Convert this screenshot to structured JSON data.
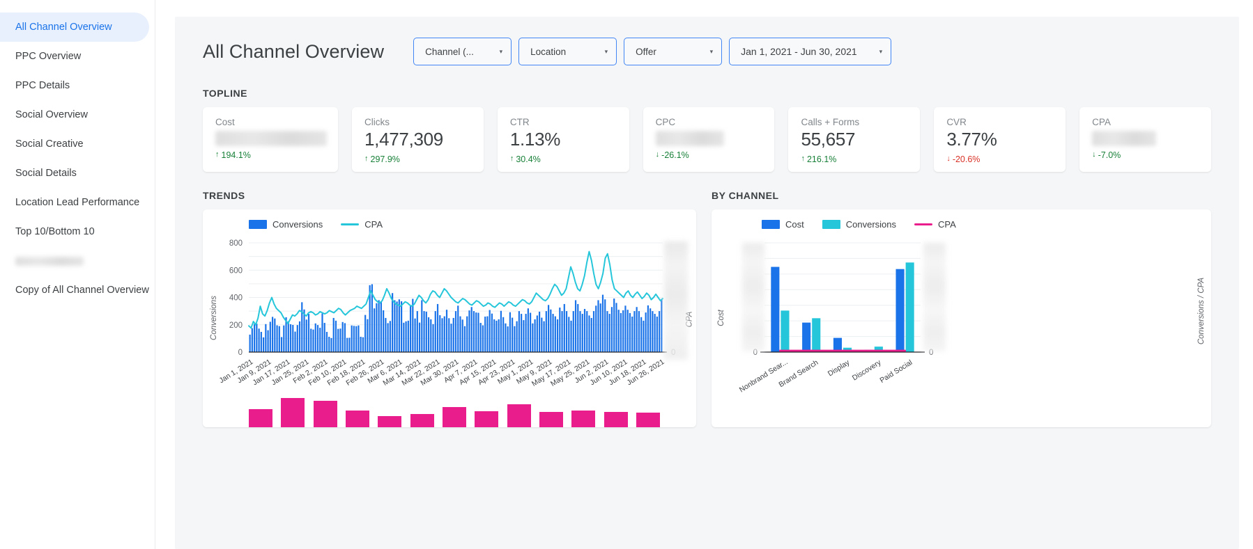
{
  "sidebar": {
    "items": [
      {
        "label": "All Channel Overview",
        "active": true,
        "redacted": false
      },
      {
        "label": "PPC Overview",
        "active": false,
        "redacted": false
      },
      {
        "label": "PPC Details",
        "active": false,
        "redacted": false
      },
      {
        "label": "Social Overview",
        "active": false,
        "redacted": false
      },
      {
        "label": "Social Creative",
        "active": false,
        "redacted": false
      },
      {
        "label": "Social Details",
        "active": false,
        "redacted": false
      },
      {
        "label": "Location Lead Performance",
        "active": false,
        "redacted": false
      },
      {
        "label": "Top 10/Bottom 10",
        "active": false,
        "redacted": false
      },
      {
        "label": "",
        "active": false,
        "redacted": true
      },
      {
        "label": "Copy of All Channel Overview",
        "active": false,
        "redacted": false
      }
    ]
  },
  "header": {
    "title": "All Channel Overview",
    "filters": [
      {
        "label": "Channel (...",
        "name": "channel-filter"
      },
      {
        "label": "Location",
        "name": "location-filter"
      },
      {
        "label": "Offer",
        "name": "offer-filter"
      },
      {
        "label": "Jan 1, 2021 - Jun 30, 2021",
        "name": "date-range-filter"
      }
    ],
    "caret": "▾"
  },
  "topline": {
    "title": "TOPLINE",
    "cards": [
      {
        "label": "Cost",
        "value": "",
        "redacted": true,
        "delta": "194.1%",
        "dir": "up",
        "arrow": "↑",
        "tone": "up"
      },
      {
        "label": "Clicks",
        "value": "1,477,309",
        "redacted": false,
        "delta": "297.9%",
        "dir": "up",
        "arrow": "↑",
        "tone": "up"
      },
      {
        "label": "CTR",
        "value": "1.13%",
        "redacted": false,
        "delta": "30.4%",
        "dir": "up",
        "arrow": "↑",
        "tone": "up"
      },
      {
        "label": "CPC",
        "value": "",
        "redacted": true,
        "delta": "-26.1%",
        "dir": "down",
        "arrow": "↓",
        "tone": "down-good"
      },
      {
        "label": "Calls + Forms",
        "value": "55,657",
        "redacted": false,
        "delta": "216.1%",
        "dir": "up",
        "arrow": "↑",
        "tone": "up"
      },
      {
        "label": "CVR",
        "value": "3.77%",
        "redacted": false,
        "delta": "-20.6%",
        "dir": "down",
        "arrow": "↓",
        "tone": "down-bad"
      },
      {
        "label": "CPA",
        "value": "",
        "redacted": true,
        "delta": "-7.0%",
        "dir": "down",
        "arrow": "↓",
        "tone": "down-good"
      }
    ]
  },
  "trends": {
    "title": "TRENDS"
  },
  "by_channel": {
    "title": "BY CHANNEL"
  },
  "colors": {
    "conversions_blue": "#1a73e8",
    "cpa_cyan": "#26c6da",
    "cost_blue": "#1a73e8",
    "conversions_teal": "#26c6da",
    "cpa_pink": "#e91e8c",
    "accent_nav": "#1a73e8",
    "nav_active_bg": "#e8f0fe",
    "positive": "#188038",
    "negative": "#d93025",
    "canvas_bg": "#f5f6f7"
  },
  "chart_data": [
    {
      "type": "bar",
      "name": "trends",
      "title": "TRENDS",
      "xlabel": "",
      "ylabel": "Conversions",
      "y2label": "CPA",
      "ylim": [
        0,
        800
      ],
      "yticks": [
        0,
        200,
        400,
        600,
        800
      ],
      "y2_ticks_redacted": true,
      "grid": true,
      "legend_position": "top-left",
      "legend": [
        "Conversions",
        "CPA"
      ],
      "x_tick_labels": [
        "Jan 1, 2021",
        "Jan 9, 2021",
        "Jan 17, 2021",
        "Jan 25, 2021",
        "Feb 2, 2021",
        "Feb 10, 2021",
        "Feb 18, 2021",
        "Feb 26, 2021",
        "Mar 6, 2021",
        "Mar 14, 2021",
        "Mar 22, 2021",
        "Mar 30, 2021",
        "Apr 7, 2021",
        "Apr 15, 2021",
        "Apr 23, 2021",
        "May 1, 2021",
        "May 9, 2021",
        "May 17, 2021",
        "May 25, 2021",
        "Jun 2, 2021",
        "Jun 10, 2021",
        "Jun 18, 2021",
        "Jun 26, 2021"
      ],
      "x_tick_step_days": 8,
      "series": [
        {
          "name": "Conversions",
          "kind": "bar",
          "axis": "left",
          "color": "#1a73e8",
          "values": [
            128,
            175,
            205,
            208,
            172,
            148,
            108,
            205,
            160,
            222,
            258,
            246,
            196,
            190,
            110,
            195,
            255,
            226,
            204,
            199,
            150,
            198,
            225,
            365,
            312,
            238,
            280,
            171,
            165,
            210,
            198,
            178,
            283,
            214,
            148,
            112,
            103,
            250,
            230,
            170,
            172,
            220,
            212,
            104,
            105,
            195,
            192,
            190,
            195,
            112,
            109,
            272,
            241,
            490,
            497,
            320,
            358,
            380,
            372,
            306,
            250,
            212,
            228,
            432,
            380,
            370,
            386,
            372,
            215,
            225,
            230,
            336,
            390,
            246,
            300,
            216,
            380,
            300,
            296,
            255,
            240,
            205,
            300,
            352,
            270,
            248,
            262,
            310,
            248,
            208,
            250,
            300,
            340,
            262,
            238,
            190,
            262,
            305,
            330,
            300,
            290,
            288,
            214,
            196,
            260,
            262,
            308,
            282,
            240,
            230,
            240,
            302,
            256,
            210,
            188,
            292,
            252,
            190,
            226,
            300,
            280,
            234,
            280,
            320,
            288,
            210,
            240,
            268,
            296,
            252,
            226,
            300,
            345,
            312,
            280,
            262,
            240,
            326,
            300,
            352,
            300,
            258,
            230,
            300,
            380,
            352,
            300,
            280,
            316,
            300,
            268,
            250,
            300,
            340,
            380,
            356,
            420,
            386,
            300,
            280,
            330,
            392,
            360,
            310,
            286,
            306,
            340,
            310,
            286,
            260,
            300,
            330,
            300,
            256,
            230,
            290,
            342,
            320,
            300,
            280,
            260,
            300,
            390
          ]
        },
        {
          "name": "CPA",
          "kind": "line",
          "axis": "right",
          "color": "#26c6da",
          "values_note": "CPA axis values are blurred/redacted in the screenshot; shape plotted on secondary axis",
          "normalized_values": [
            0.24,
            0.22,
            0.28,
            0.25,
            0.31,
            0.42,
            0.35,
            0.33,
            0.38,
            0.45,
            0.5,
            0.44,
            0.4,
            0.38,
            0.36,
            0.32,
            0.29,
            0.26,
            0.3,
            0.34,
            0.33,
            0.35,
            0.38,
            0.37,
            0.35,
            0.33,
            0.36,
            0.37,
            0.36,
            0.34,
            0.35,
            0.37,
            0.36,
            0.35,
            0.36,
            0.38,
            0.37,
            0.36,
            0.38,
            0.4,
            0.39,
            0.36,
            0.34,
            0.36,
            0.38,
            0.39,
            0.4,
            0.42,
            0.41,
            0.4,
            0.42,
            0.44,
            0.5,
            0.56,
            0.52,
            0.48,
            0.46,
            0.45,
            0.47,
            0.52,
            0.58,
            0.54,
            0.49,
            0.46,
            0.44,
            0.43,
            0.42,
            0.44,
            0.46,
            0.45,
            0.43,
            0.42,
            0.44,
            0.48,
            0.52,
            0.5,
            0.47,
            0.45,
            0.48,
            0.53,
            0.56,
            0.55,
            0.52,
            0.5,
            0.54,
            0.58,
            0.56,
            0.53,
            0.5,
            0.48,
            0.46,
            0.45,
            0.47,
            0.49,
            0.48,
            0.46,
            0.44,
            0.43,
            0.45,
            0.47,
            0.46,
            0.44,
            0.42,
            0.43,
            0.45,
            0.44,
            0.42,
            0.41,
            0.43,
            0.45,
            0.44,
            0.42,
            0.44,
            0.46,
            0.45,
            0.43,
            0.42,
            0.44,
            0.46,
            0.48,
            0.47,
            0.45,
            0.44,
            0.46,
            0.5,
            0.54,
            0.52,
            0.5,
            0.48,
            0.47,
            0.49,
            0.53,
            0.58,
            0.62,
            0.6,
            0.56,
            0.52,
            0.54,
            0.58,
            0.68,
            0.78,
            0.72,
            0.64,
            0.58,
            0.56,
            0.62,
            0.7,
            0.82,
            0.92,
            0.84,
            0.72,
            0.62,
            0.58,
            0.64,
            0.72,
            0.86,
            0.9,
            0.8,
            0.66,
            0.58,
            0.56,
            0.54,
            0.52,
            0.5,
            0.54,
            0.56,
            0.52,
            0.5,
            0.53,
            0.55,
            0.52,
            0.49,
            0.51,
            0.54,
            0.52,
            0.48,
            0.5,
            0.53,
            0.5,
            0.47,
            0.49
          ]
        }
      ],
      "secondary_pink_bars": {
        "name": "secondary-pink-series",
        "color": "#e91e8c",
        "clipped": true,
        "normalized_values": [
          0.6,
          0.95,
          0.86,
          0.55,
          0.36,
          0.44,
          0.66,
          0.52,
          0.74,
          0.5,
          0.54,
          0.5,
          0.48
        ]
      }
    },
    {
      "type": "bar",
      "name": "by_channel",
      "title": "BY CHANNEL",
      "xlabel": "",
      "ylabel": "Cost",
      "y2label": "Conversions / CPA",
      "grid": true,
      "legend_position": "top-left",
      "legend": [
        "Cost",
        "Conversions",
        "CPA"
      ],
      "y_ticks_redacted": true,
      "y_zero_label": "0",
      "y2_zero_label": "0",
      "categories": [
        "Nonbrand Sear...",
        "Brand Search",
        "Display",
        "Discovery",
        "Paid Social"
      ],
      "series": [
        {
          "name": "Cost",
          "kind": "bar",
          "axis": "left",
          "color": "#1a73e8",
          "normalized_values": [
            0.78,
            0.27,
            0.13,
            0.02,
            0.76
          ]
        },
        {
          "name": "Conversions",
          "kind": "bar",
          "axis": "right",
          "color": "#26c6da",
          "normalized_values": [
            0.38,
            0.31,
            0.04,
            0.05,
            0.82
          ]
        },
        {
          "name": "CPA",
          "kind": "line",
          "axis": "right",
          "color": "#e91e8c",
          "normalized_values": [
            0.012,
            0.012,
            0.012,
            0.012,
            0.012
          ]
        }
      ]
    }
  ]
}
